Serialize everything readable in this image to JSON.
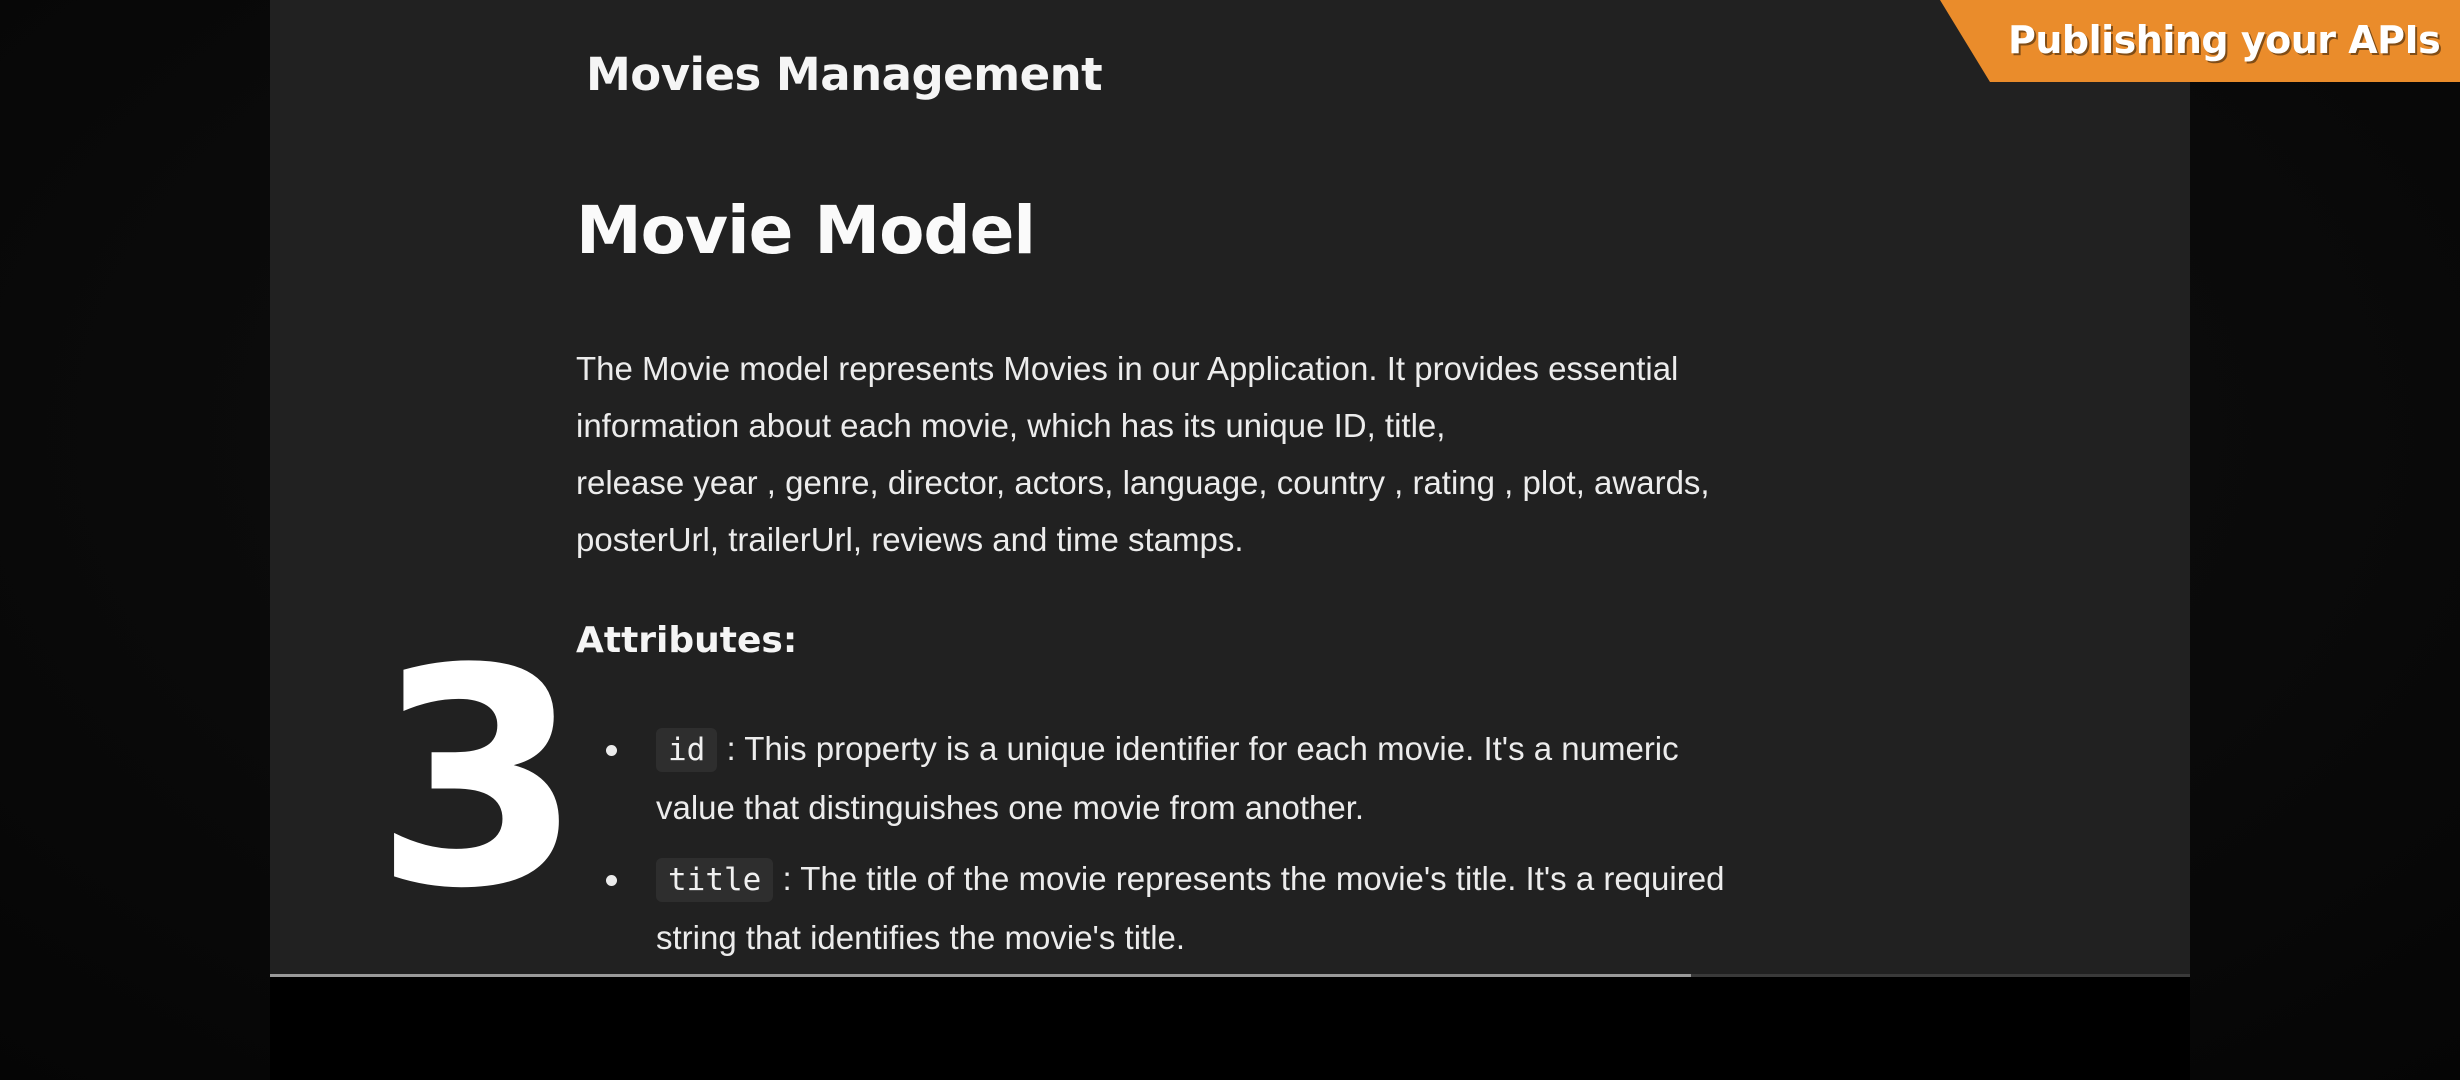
{
  "banner": {
    "label": "Publishing your APIs"
  },
  "app": {
    "title": "Movies Management"
  },
  "main": {
    "heading": "Movie Model",
    "description_lines": [
      "The Movie model represents Movies in our Application. It provides essential",
      "information about each movie, which has its unique ID, title,",
      "release year , genre, director, actors, language, country , rating , plot, awards,",
      "posterUrl, trailerUrl, reviews and time stamps."
    ],
    "attributes_heading": "Attributes:",
    "attributes": [
      {
        "code": "id",
        "line1": ": This property is a unique identifier for each movie. It's a numeric",
        "line2": "value that distinguishes one movie from another."
      },
      {
        "code": "title",
        "line1": ": The title of the movie represents the movie's title. It's a required",
        "line2": "string that identifies the movie's title."
      }
    ]
  },
  "overlay": {
    "step_number": "3"
  },
  "video": {
    "progress": 0.74
  },
  "colors": {
    "accent": "#ea8c2b",
    "background": "#212121",
    "text": "#ececec"
  }
}
